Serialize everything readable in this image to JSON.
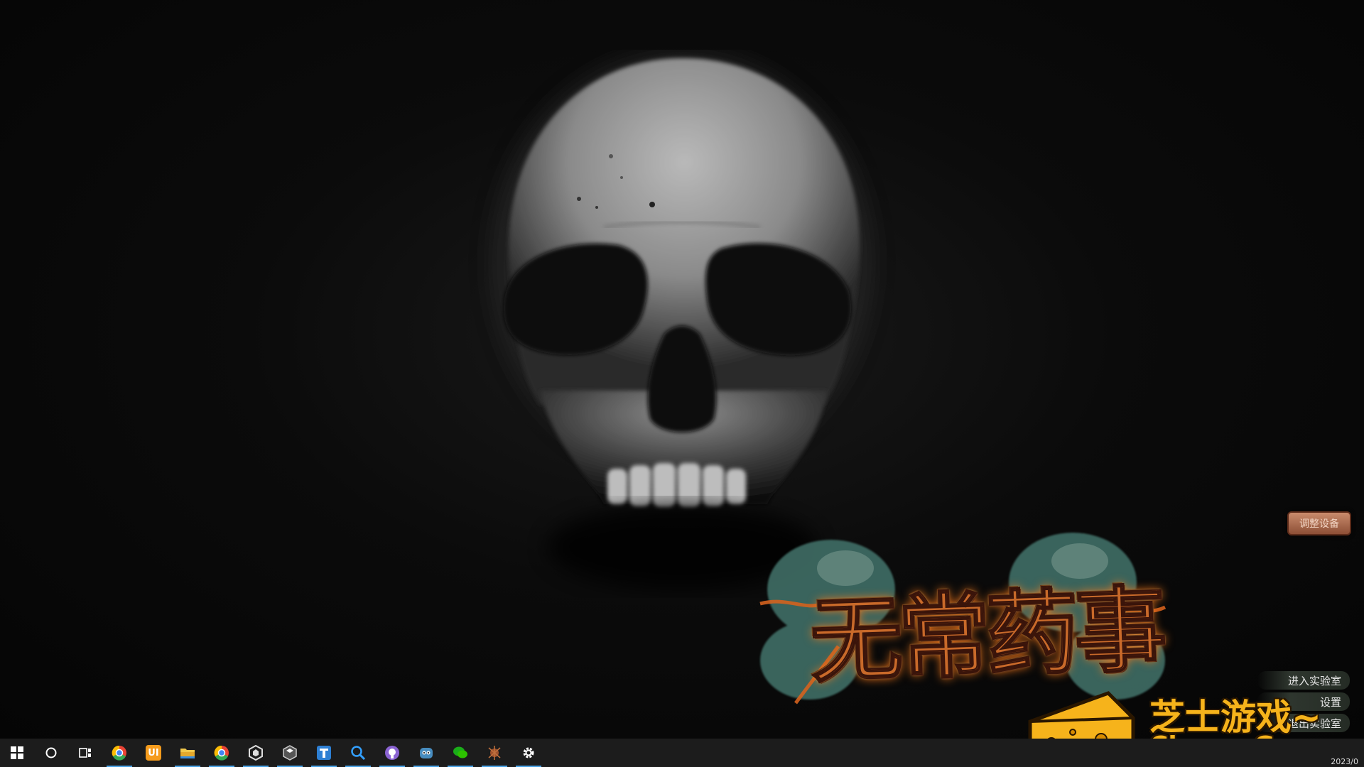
{
  "game": {
    "title_logo": "无常药事",
    "side_button": "调整设备",
    "menu": [
      "进入实验室",
      "设置",
      "退出实验室"
    ]
  },
  "watermark": {
    "line1": "芝士游戏~",
    "line2": "CheeseGame.org"
  },
  "taskbar": {
    "start": "start-icon",
    "search": "search-circle-icon",
    "taskview": "task-view-icon",
    "apps": [
      {
        "name": "chrome-icon",
        "color": "#ea4335"
      },
      {
        "name": "ui-app-icon",
        "label": "UI",
        "color": "#f59b1c"
      },
      {
        "name": "file-explorer-icon",
        "color": "#f2c94c"
      },
      {
        "name": "chrome-icon-2",
        "color": "#ea4335"
      },
      {
        "name": "unity-hub-icon",
        "color": "#dddddd"
      },
      {
        "name": "unity-icon",
        "color": "#cccccc"
      },
      {
        "name": "blue-app-icon",
        "color": "#2d7fd3"
      },
      {
        "name": "search-app-icon",
        "color": "#33a0ff"
      },
      {
        "name": "github-icon",
        "color": "#8a63d2"
      },
      {
        "name": "godot-icon",
        "color": "#478cbf"
      },
      {
        "name": "wechat-icon",
        "color": "#1aad19"
      },
      {
        "name": "game-icon",
        "color": "#a0522d"
      },
      {
        "name": "settings-gear-icon",
        "color": "#ffffff"
      }
    ],
    "clock": "2023/0"
  }
}
